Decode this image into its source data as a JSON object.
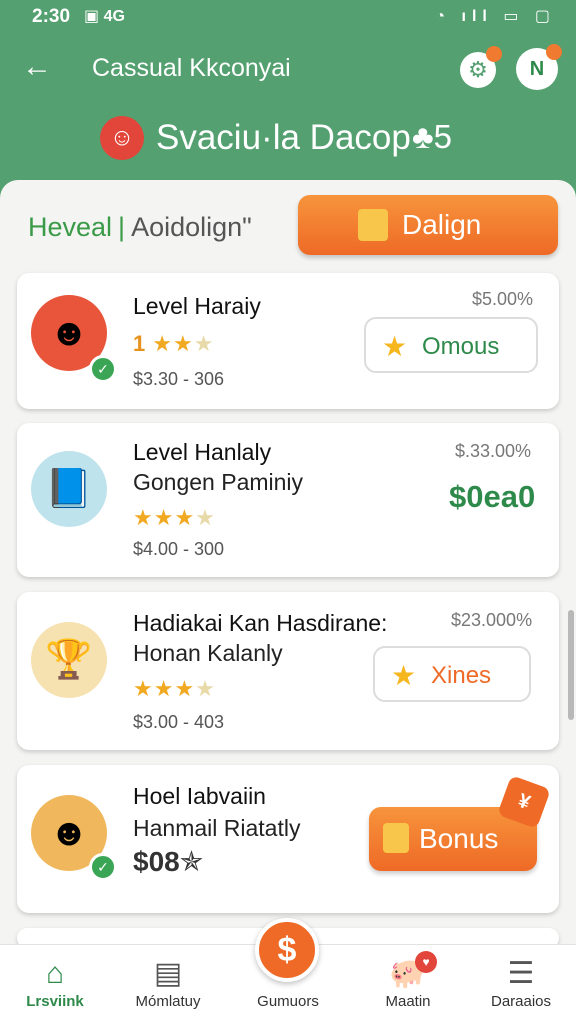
{
  "status_bar": {
    "time": "2:30",
    "left_icons": "▣ 4G",
    "right_icons": "◔ ıll ▭ ▢"
  },
  "top_bar": {
    "title": "Cassual Kkconyai"
  },
  "hero": {
    "title": "Svaciu·la Dacop",
    "badge": "♣5"
  },
  "filter": {
    "active": "Heveal",
    "separator": "|",
    "inactive": "Aoidolign\""
  },
  "primary_button": {
    "label": "Dalign"
  },
  "cards": [
    {
      "title": "Level Haraiy",
      "rating_number": "1",
      "stars_on": "★★",
      "stars_off": "★",
      "range": "$3.30 - 306",
      "price": "$5.00%",
      "action_label": "Omous"
    },
    {
      "title": "Level Hanlaly",
      "subtitle": "Gongen Paminiy",
      "stars_on": "★★★",
      "stars_off": "★",
      "range": "$4.00 - 300",
      "price": "$.33.00%",
      "amount": "$0ea0"
    },
    {
      "title": "Hadiakai Kan Hasdirane:",
      "subtitle": "Honan Kalanly",
      "stars_on": "★★★",
      "stars_off": "★",
      "range": "$3.00 - 403",
      "price": "$23.000%",
      "action_label": "Xines"
    },
    {
      "title": "Hoel Iabvaiin",
      "subtitle": "Hanmail Riatatly",
      "amount": "$08✯",
      "action_label": "Bonus"
    }
  ],
  "bottom_nav": [
    {
      "label": "Lrsviink",
      "icon": "home-icon"
    },
    {
      "label": "Mómlatuy",
      "icon": "calendar-icon"
    },
    {
      "label": "Gumuors",
      "icon": "dollar-icon"
    },
    {
      "label": "Maatin",
      "icon": "pig-icon"
    },
    {
      "label": "Daraaios",
      "icon": "menu-icon"
    }
  ],
  "colors": {
    "header": "#54a070",
    "accent": "#ee6a26",
    "green": "#2e8a4a"
  }
}
